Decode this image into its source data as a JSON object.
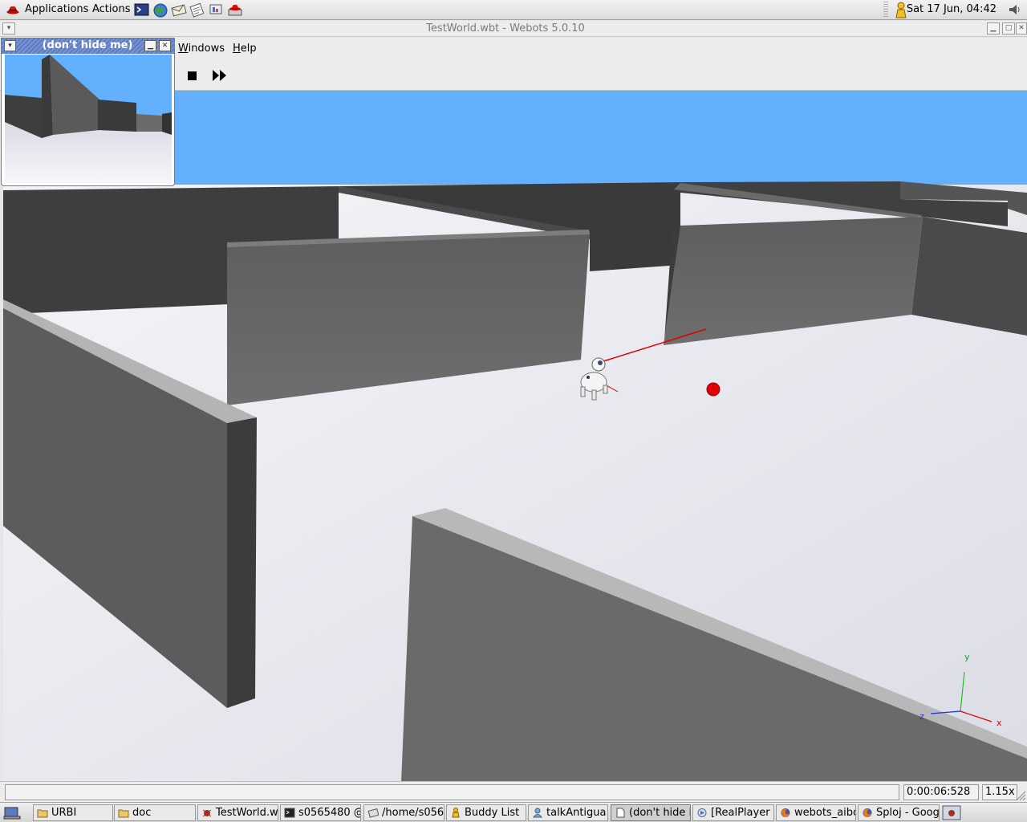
{
  "top_panel": {
    "menus": [
      "Applications",
      "Actions"
    ],
    "launchers": [
      "terminal-icon",
      "web-browser-icon",
      "email-icon",
      "writer-icon",
      "presentation-icon",
      "redhat-network-icon"
    ],
    "clock": "Sat 17 Jun, 04:42"
  },
  "window": {
    "title": "TestWorld.wbt - Webots 5.0.10",
    "menus": [
      {
        "label": "Windows",
        "mnemonic": "W",
        "rest": "indows"
      },
      {
        "label": "Help",
        "mnemonic": "H",
        "rest": "elp"
      }
    ],
    "toolbar": [
      "stop-icon",
      "fast-forward-icon"
    ],
    "status": {
      "message": "",
      "time": "0:00:06:528",
      "speed": "1.15x"
    },
    "axes_labels": {
      "x": "x",
      "y": "y",
      "z": "z"
    }
  },
  "camera_window": {
    "title": "(don't hide me)"
  },
  "taskbar": {
    "items": [
      {
        "label": "URBI",
        "icon": "folder-icon"
      },
      {
        "label": "doc",
        "icon": "folder-icon"
      },
      {
        "label": "TestWorld.wl",
        "icon": "webots-icon"
      },
      {
        "label": "s0565480 @",
        "icon": "terminal-icon"
      },
      {
        "label": "/home/s056",
        "icon": "file-manager-icon"
      },
      {
        "label": "Buddy List",
        "icon": "buddy-icon"
      },
      {
        "label": "talkAntigua.c",
        "icon": "person-icon"
      },
      {
        "label": "(don't hide i",
        "icon": "document-icon"
      },
      {
        "label": "[RealPlayer -",
        "icon": "realplayer-icon"
      },
      {
        "label": "webots_aibo",
        "icon": "firefox-icon"
      },
      {
        "label": "Sploj - Goog",
        "icon": "firefox-icon"
      }
    ]
  },
  "colors": {
    "sky": "#62b0fe",
    "ground": "#e8e8ee",
    "wall_dark": "#4a4a4a",
    "wall_mid": "#5c5c5c",
    "wall_top": "#b4b4b4",
    "ball": "#e00000",
    "title_gradient": "#5d7bc0"
  }
}
